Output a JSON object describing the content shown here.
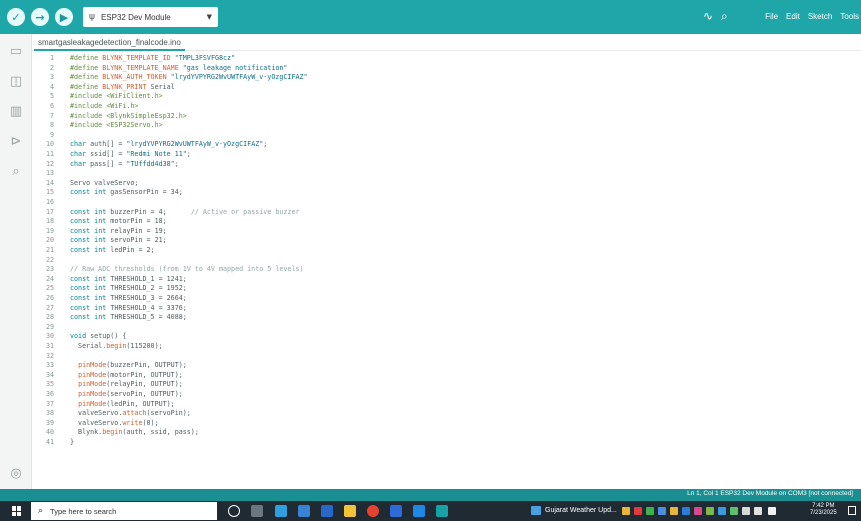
{
  "toolbar": {
    "board": "ESP32 Dev Module",
    "menu": [
      "File",
      "Edit",
      "Sketch",
      "Tools"
    ]
  },
  "tab": {
    "filename": "smartgasleakagedetection_finalcode.ino"
  },
  "code_lines": [
    {
      "n": "1",
      "t": "#define BLYNK_TEMPLATE_ID \"TMPL3FSVFG8cz\""
    },
    {
      "n": "2",
      "t": "#define BLYNK_TEMPLATE_NAME \"gas leakage notification\""
    },
    {
      "n": "3",
      "t": "#define BLYNK_AUTH_TOKEN \"lrydYVPYRG2WvUWTFAyW_v-yOzgCIFAZ\""
    },
    {
      "n": "4",
      "t": "#define BLYNK_PRINT Serial"
    },
    {
      "n": "5",
      "t": "#include <WiFiClient.h>"
    },
    {
      "n": "6",
      "t": "#include <WiFi.h>"
    },
    {
      "n": "7",
      "t": "#include <BlynkSimpleEsp32.h>"
    },
    {
      "n": "8",
      "t": "#include <ESP32Servo.h>"
    },
    {
      "n": "9",
      "t": ""
    },
    {
      "n": "10",
      "t": "char auth[] = \"lrydYVPYRG2WvUWTFAyW_v-yOzgCIFAZ\";"
    },
    {
      "n": "11",
      "t": "char ssid[] = \"Redmi Note 11\";"
    },
    {
      "n": "12",
      "t": "char pass[] = \"TUffdd4d38\";"
    },
    {
      "n": "13",
      "t": ""
    },
    {
      "n": "14",
      "t": "Servo valveServo;"
    },
    {
      "n": "15",
      "t": "const int gasSensorPin = 34;"
    },
    {
      "n": "16",
      "t": ""
    },
    {
      "n": "17",
      "t": "const int buzzerPin = 4;      // Active or passive buzzer"
    },
    {
      "n": "18",
      "t": "const int motorPin = 18;"
    },
    {
      "n": "19",
      "t": "const int relayPin = 19;"
    },
    {
      "n": "20",
      "t": "const int servoPin = 21;"
    },
    {
      "n": "21",
      "t": "const int ledPin = 2;"
    },
    {
      "n": "22",
      "t": ""
    },
    {
      "n": "23",
      "t": "// Raw ADC thresholds (from 1V to 4V mapped into 5 levels)"
    },
    {
      "n": "24",
      "t": "const int THRESHOLD_1 = 1241;"
    },
    {
      "n": "25",
      "t": "const int THRESHOLD_2 = 1952;"
    },
    {
      "n": "26",
      "t": "const int THRESHOLD_3 = 2664;"
    },
    {
      "n": "27",
      "t": "const int THRESHOLD_4 = 3376;"
    },
    {
      "n": "28",
      "t": "const int THRESHOLD_5 = 4088;"
    },
    {
      "n": "29",
      "t": ""
    },
    {
      "n": "30",
      "t": "void setup() {"
    },
    {
      "n": "31",
      "t": "  Serial.begin(115200);"
    },
    {
      "n": "32",
      "t": ""
    },
    {
      "n": "33",
      "t": "  pinMode(buzzerPin, OUTPUT);"
    },
    {
      "n": "34",
      "t": "  pinMode(motorPin, OUTPUT);"
    },
    {
      "n": "35",
      "t": "  pinMode(relayPin, OUTPUT);"
    },
    {
      "n": "36",
      "t": "  pinMode(servoPin, OUTPUT);"
    },
    {
      "n": "37",
      "t": "  pinMode(ledPin, OUTPUT);"
    },
    {
      "n": "38",
      "t": "  valveServo.attach(servoPin);"
    },
    {
      "n": "39",
      "t": "  valveServo.write(0);"
    },
    {
      "n": "40",
      "t": "  Blynk.begin(auth, ssid, pass);"
    },
    {
      "n": "41",
      "t": "}"
    }
  ],
  "statusbar": {
    "text": "Ln 1, Col 1   ESP32 Dev Module on COM3 [not connected]"
  },
  "taskbar": {
    "search_placeholder": "Type here to search",
    "weather": "Gujarat Weather Upd...",
    "time": "7:42 PM",
    "date": "7/23/2025"
  },
  "colors": {
    "toolbar": "#1ea6a9",
    "statusbar": "#1a8f92",
    "taskbar": "#1f2a33"
  },
  "icons": {
    "verify": "check-icon",
    "upload": "arrow-right-icon",
    "debug": "debug-icon",
    "serial_plotter": "plotter-icon",
    "serial_monitor": "serial-monitor-icon"
  }
}
